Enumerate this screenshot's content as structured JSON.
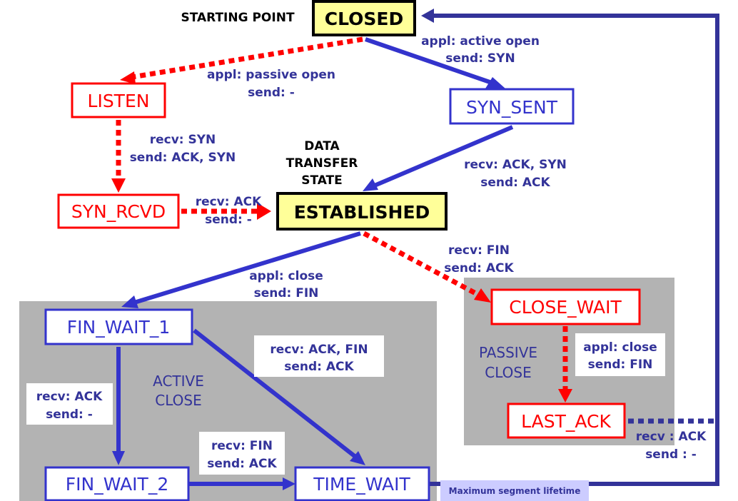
{
  "colors": {
    "active": "#3333cc",
    "passive": "#ff0000",
    "key_state_fill": "#ffff99",
    "region": "#b3b3b3",
    "label_text": "#333399",
    "timer_box": "#ccccff"
  },
  "states": {
    "closed": "CLOSED",
    "listen": "LISTEN",
    "syn_sent": "SYN_SENT",
    "syn_rcvd": "SYN_RCVD",
    "established": "ESTABLISHED",
    "close_wait": "CLOSE_WAIT",
    "last_ack": "LAST_ACK",
    "fin_wait_1": "FIN_WAIT_1",
    "fin_wait_2": "FIN_WAIT_2",
    "time_wait": "TIME_WAIT"
  },
  "annotations": {
    "starting_point": "STARTING POINT",
    "data_transfer": [
      "DATA",
      "TRANSFER",
      "STATE"
    ],
    "active_close": [
      "ACTIVE",
      "CLOSE"
    ],
    "passive_close": [
      "PASSIVE",
      "CLOSE"
    ],
    "msl": "Maximum segment lifetime"
  },
  "transitions": {
    "closed_syn_sent": [
      "appl: active open",
      "send: SYN"
    ],
    "closed_listen": [
      "appl: passive open",
      "send: -"
    ],
    "listen_syn_rcvd": [
      "recv: SYN",
      "send: ACK, SYN"
    ],
    "syn_sent_established": [
      "recv: ACK, SYN",
      "send: ACK"
    ],
    "syn_rcvd_established": [
      "recv: ACK",
      "send: -"
    ],
    "established_fin_wait_1": [
      "appl: close",
      "send: FIN"
    ],
    "established_close_wait": [
      "recv: FIN",
      "send: ACK"
    ],
    "fin_wait_1_time_wait": [
      "recv: ACK, FIN",
      "send: ACK"
    ],
    "fin_wait_1_fin_wait_2": [
      "recv: ACK",
      "send: -"
    ],
    "fin_wait_2_time_wait": [
      "recv: FIN",
      "send: ACK"
    ],
    "close_wait_last_ack": [
      "appl: close",
      "send: FIN"
    ],
    "last_ack_closed": [
      "recv : ACK",
      "send : -"
    ]
  }
}
